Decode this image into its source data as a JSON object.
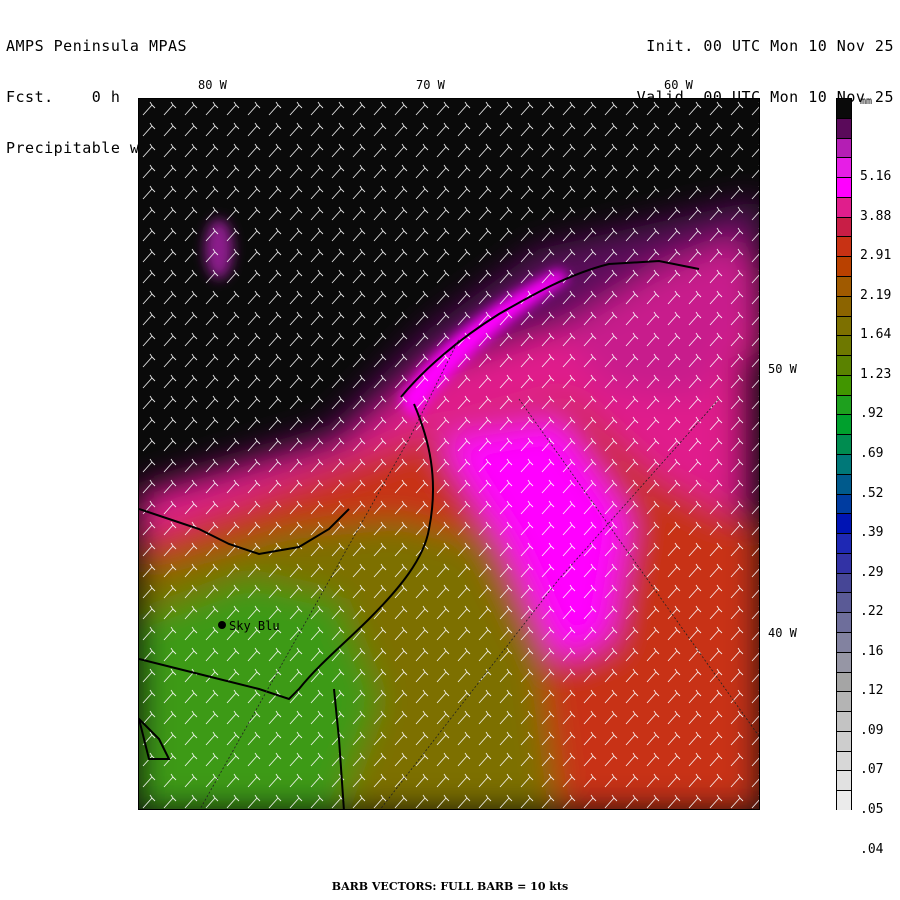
{
  "header": {
    "model": "AMPS Peninsula MPAS",
    "forecast": "Fcst.    0 h",
    "field": "Precipitable water vapor",
    "init": "Init. 00 UTC Mon 10 Nov 25",
    "valid": "Valid. 00 UTC Mon 10 Nov 25"
  },
  "map": {
    "lon_labels": [
      "80 W",
      "70 W",
      "60 W"
    ],
    "lat_labels": [
      "50 W",
      "40 W"
    ],
    "station": "Sky Blu"
  },
  "colorbar": {
    "unit": "mm",
    "labels": [
      "5.16",
      "3.88",
      "2.91",
      "2.19",
      "1.64",
      "1.23",
      ".92",
      ".69",
      ".52",
      ".39",
      ".29",
      ".22",
      ".16",
      ".12",
      ".09",
      ".07",
      ".05",
      ".04"
    ],
    "colors": [
      "#0a0a0a",
      "#5a0a5a",
      "#b41eb4",
      "#e61ee6",
      "#ff00ff",
      "#e01e8c",
      "#c81e46",
      "#c83214",
      "#b94100",
      "#a05a00",
      "#8c6400",
      "#7d7000",
      "#6e7800",
      "#5a8200",
      "#419600",
      "#1ea01e",
      "#00a02d",
      "#008c50",
      "#007878",
      "#005a8c",
      "#003ca0",
      "#0014b4",
      "#1e28b4",
      "#3232a5",
      "#464696",
      "#5a5a96",
      "#6e6e9b",
      "#8282a0",
      "#9696a5",
      "#a5a5a5",
      "#b4b4b4",
      "#c3c3c3",
      "#cdcdcd",
      "#d7d7d7",
      "#e1e1e1",
      "#ebebeb"
    ]
  },
  "footer": {
    "barb_note": "BARB VECTORS:  FULL BARB = 10 kts"
  }
}
